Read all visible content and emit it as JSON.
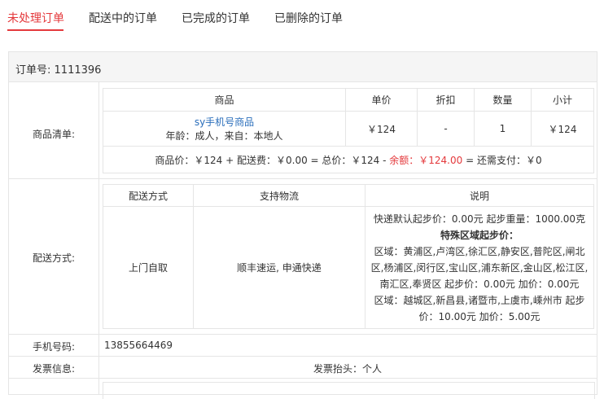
{
  "tabs": [
    {
      "label": "未处理订单",
      "active": true
    },
    {
      "label": "配送中的订单",
      "active": false
    },
    {
      "label": "已完成的订单",
      "active": false
    },
    {
      "label": "已删除的订单",
      "active": false
    }
  ],
  "order": {
    "label": "订单号:",
    "number": "1111396"
  },
  "goods": {
    "row_label": "商品清单:",
    "headers": [
      "商品",
      "单价",
      "折扣",
      "数量",
      "小计"
    ],
    "item": {
      "name": "sy手机号商品",
      "meta": "年龄：成人，来自：本地人",
      "price": "￥124",
      "discount": "-",
      "quantity": "1",
      "subtotal": "￥124"
    },
    "summary": {
      "goods_price": "商品价：￥124 + 配送费：￥0.00 = 总价：￥124 - ",
      "balance": "余额：￥124.00",
      "due": " = 还需支付：￥0"
    }
  },
  "delivery": {
    "row_label": "配送方式:",
    "headers": [
      "配送方式",
      "支持物流",
      "说明"
    ],
    "method": "上门自取",
    "logistics": "顺丰速运, 申通快递",
    "desc_line1": "快递默认起步价：0.00元   起步重量：1000.00克",
    "desc_title": "特殊区域起步价：",
    "desc_area1": "区域：黄浦区,卢湾区,徐汇区,静安区,普陀区,闸北区,杨浦区,闵行区,宝山区,浦东新区,金山区,松江区,南汇区,奉贤区  起步价：0.00元  加价：0.00元",
    "desc_area2": "区域：越城区,新昌县,诸暨市,上虞市,嵊州市  起步价：10.00元  加价：5.00元"
  },
  "phone": {
    "row_label": "手机号码:",
    "value": "13855664469"
  },
  "invoice": {
    "row_label": "发票信息:",
    "value": "发票抬头：个人"
  }
}
